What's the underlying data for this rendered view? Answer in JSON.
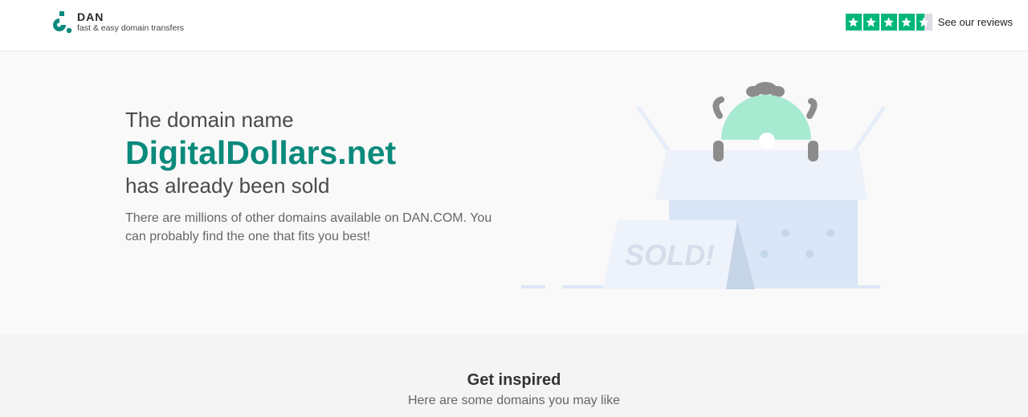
{
  "header": {
    "logo_name": "DAN",
    "logo_tagline": "fast & easy domain transfers",
    "reviews_label": "See our reviews",
    "rating_stars": 4.5,
    "brand_color": "#0b8a7c",
    "star_color": "#00b67a"
  },
  "hero": {
    "pre_title": "The domain name",
    "domain": "DigitalDollars.net",
    "post_title": "has already been sold",
    "description": "There are millions of other domains available on DAN.COM. You can probably find the one that fits you best!",
    "sign_text": "SOLD!"
  },
  "inspire": {
    "title": "Get inspired",
    "subtitle": "Here are some domains you may like"
  }
}
